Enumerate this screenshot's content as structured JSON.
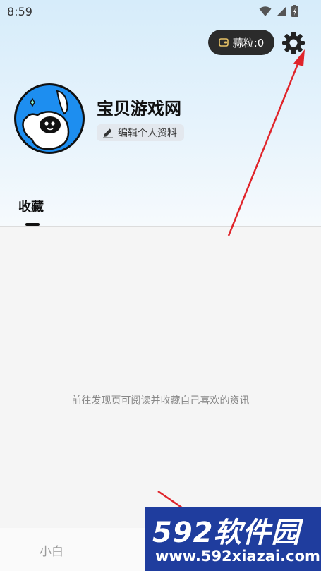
{
  "status_bar": {
    "time": "8:59"
  },
  "header": {
    "coin_label": "蒜粒:0"
  },
  "profile": {
    "name": "宝贝游戏网",
    "edit_label": "编辑个人资料"
  },
  "tabs": [
    {
      "label": "收藏",
      "active": true
    }
  ],
  "content": {
    "empty_message": "前往发现页可阅读并收藏自己喜欢的资讯"
  },
  "bottom_nav": {
    "items": [
      {
        "label": "小白"
      }
    ]
  },
  "watermark": {
    "title": "592软件园",
    "url": "www.592xiazai.com"
  },
  "colors": {
    "accent_dark": "#2b2b2b",
    "avatar_blue": "#1d8ef0",
    "arrow_red": "#e0242a",
    "watermark_blue": "#1f3d9e"
  },
  "icons": [
    "wifi-icon",
    "signal-icon",
    "battery-icon",
    "wallet-icon",
    "gear-icon",
    "pencil-icon"
  ]
}
